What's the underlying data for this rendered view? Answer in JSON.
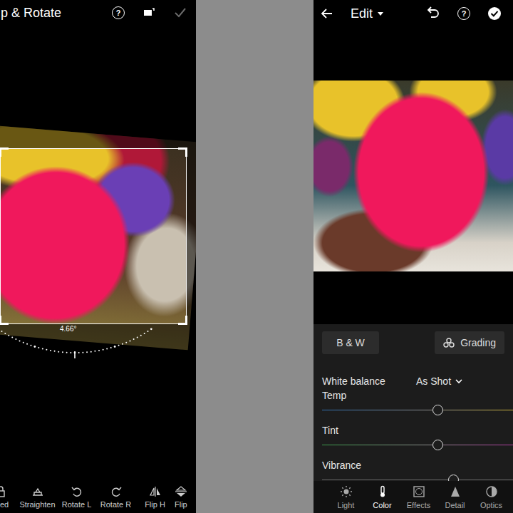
{
  "crop_screen": {
    "title": "p & Rotate",
    "help_icon": "?",
    "done_enabled": false,
    "angle": "4.66°",
    "tools": [
      {
        "label": "ed",
        "kind": "lock"
      },
      {
        "label": "Straighten",
        "kind": "straighten"
      },
      {
        "label": "Rotate L",
        "kind": "rotleft"
      },
      {
        "label": "Rotate R",
        "kind": "rotright"
      },
      {
        "label": "Flip H",
        "kind": "fliph"
      },
      {
        "label": "Flip",
        "kind": "flipv"
      }
    ]
  },
  "edit_screen": {
    "title": "Edit",
    "help_icon": "?",
    "mode_buttons": [
      {
        "label": "B & W",
        "kind": "plain"
      },
      {
        "label": "Grading",
        "kind": "grading"
      }
    ],
    "white_balance": {
      "label": "White balance",
      "value": "As Shot"
    },
    "sliders": [
      {
        "label": "Temp",
        "level": 0.61,
        "kind": "temp"
      },
      {
        "label": "Tint",
        "level": 0.61,
        "kind": "tint"
      },
      {
        "label": "Vibrance",
        "level": 0.69,
        "kind": "plain"
      }
    ],
    "tabs": [
      {
        "label": "Light",
        "kind": "light",
        "selected": false
      },
      {
        "label": "Color",
        "kind": "color",
        "selected": true
      },
      {
        "label": "Effects",
        "kind": "effects",
        "selected": false
      },
      {
        "label": "Detail",
        "kind": "detail",
        "selected": false
      },
      {
        "label": "Optics",
        "kind": "optics",
        "selected": false
      }
    ]
  }
}
